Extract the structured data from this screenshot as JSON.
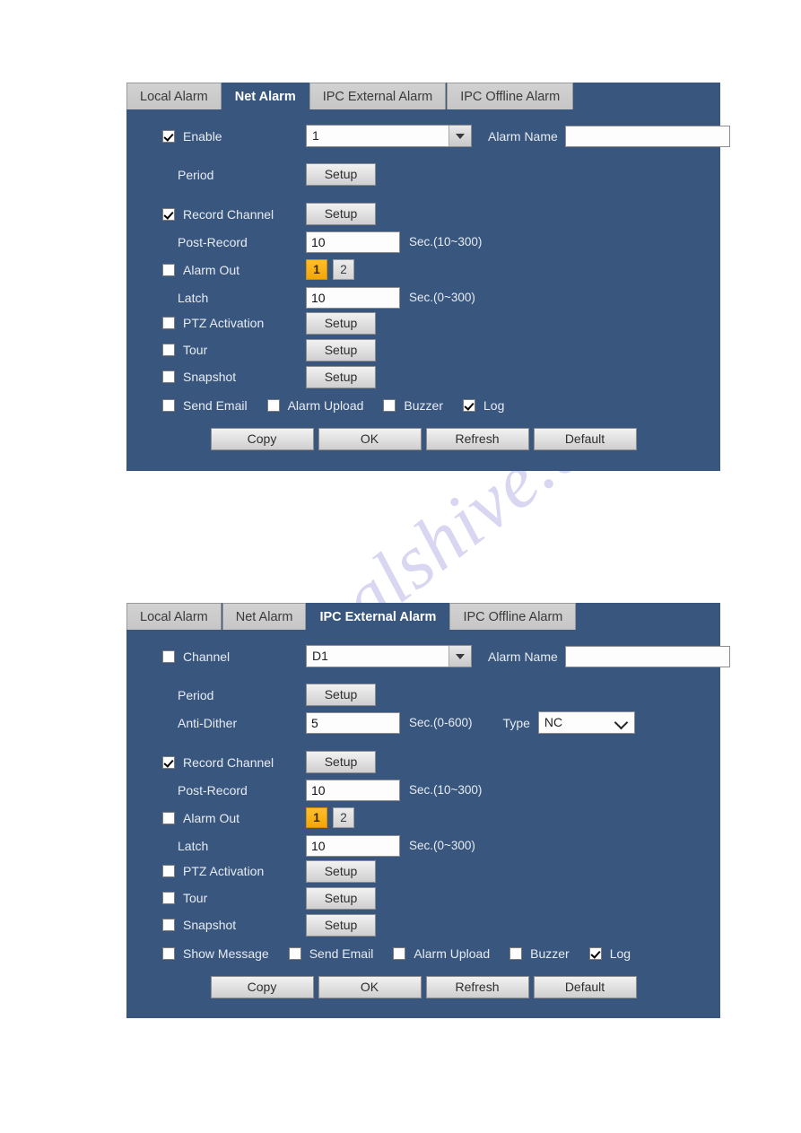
{
  "watermark": {
    "text": "manualshive.com"
  },
  "panels": [
    {
      "id": "net-alarm",
      "tabs": [
        {
          "label": "Local Alarm",
          "active": false
        },
        {
          "label": "Net Alarm",
          "active": true
        },
        {
          "label": "IPC External Alarm",
          "active": false
        },
        {
          "label": "IPC Offline Alarm",
          "active": false
        }
      ],
      "enable": {
        "label": "Enable",
        "checked": true
      },
      "channel_select": {
        "value": "1"
      },
      "alarm_name": {
        "label": "Alarm Name",
        "value": "",
        "placeholder": ""
      },
      "period": {
        "label": "Period",
        "button": "Setup"
      },
      "record_channel": {
        "label": "Record Channel",
        "checked": true,
        "button": "Setup"
      },
      "post_record": {
        "label": "Post-Record",
        "value": "10",
        "hint": "Sec.(10~300)"
      },
      "alarm_out": {
        "label": "Alarm Out",
        "checked": false,
        "options": [
          "1",
          "2"
        ],
        "selected": "1"
      },
      "latch": {
        "label": "Latch",
        "value": "10",
        "hint": "Sec.(0~300)"
      },
      "ptz_activation": {
        "label": "PTZ Activation",
        "checked": false,
        "button": "Setup"
      },
      "tour": {
        "label": "Tour",
        "checked": false,
        "button": "Setup"
      },
      "snapshot": {
        "label": "Snapshot",
        "checked": false,
        "button": "Setup"
      },
      "notify": [
        {
          "label": "Send Email",
          "checked": false
        },
        {
          "label": "Alarm Upload",
          "checked": false
        },
        {
          "label": "Buzzer",
          "checked": false
        },
        {
          "label": "Log",
          "checked": true
        }
      ],
      "footer": [
        {
          "label": "Copy"
        },
        {
          "label": "OK"
        },
        {
          "label": "Refresh"
        },
        {
          "label": "Default"
        }
      ]
    },
    {
      "id": "ipc-external-alarm",
      "tabs": [
        {
          "label": "Local Alarm",
          "active": false
        },
        {
          "label": "Net Alarm",
          "active": false
        },
        {
          "label": "IPC External Alarm",
          "active": true
        },
        {
          "label": "IPC Offline Alarm",
          "active": false
        }
      ],
      "enable": {
        "label": "Channel",
        "checked": false
      },
      "channel_select": {
        "value": "D1"
      },
      "alarm_name": {
        "label": "Alarm Name",
        "value": "",
        "placeholder": ""
      },
      "period": {
        "label": "Period",
        "button": "Setup"
      },
      "anti_dither": {
        "label": "Anti-Dither",
        "value": "5",
        "hint": "Sec.(0-600)"
      },
      "type": {
        "label": "Type",
        "value": "NC"
      },
      "record_channel": {
        "label": "Record Channel",
        "checked": true,
        "button": "Setup"
      },
      "post_record": {
        "label": "Post-Record",
        "value": "10",
        "hint": "Sec.(10~300)"
      },
      "alarm_out": {
        "label": "Alarm Out",
        "checked": false,
        "options": [
          "1",
          "2"
        ],
        "selected": "1"
      },
      "latch": {
        "label": "Latch",
        "value": "10",
        "hint": "Sec.(0~300)"
      },
      "ptz_activation": {
        "label": "PTZ Activation",
        "checked": false,
        "button": "Setup"
      },
      "tour": {
        "label": "Tour",
        "checked": false,
        "button": "Setup"
      },
      "snapshot": {
        "label": "Snapshot",
        "checked": false,
        "button": "Setup"
      },
      "notify": [
        {
          "label": "Show Message",
          "checked": false
        },
        {
          "label": "Send Email",
          "checked": false
        },
        {
          "label": "Alarm Upload",
          "checked": false
        },
        {
          "label": "Buzzer",
          "checked": false
        },
        {
          "label": "Log",
          "checked": true
        }
      ],
      "footer": [
        {
          "label": "Copy"
        },
        {
          "label": "OK"
        },
        {
          "label": "Refresh"
        },
        {
          "label": "Default"
        }
      ]
    }
  ]
}
